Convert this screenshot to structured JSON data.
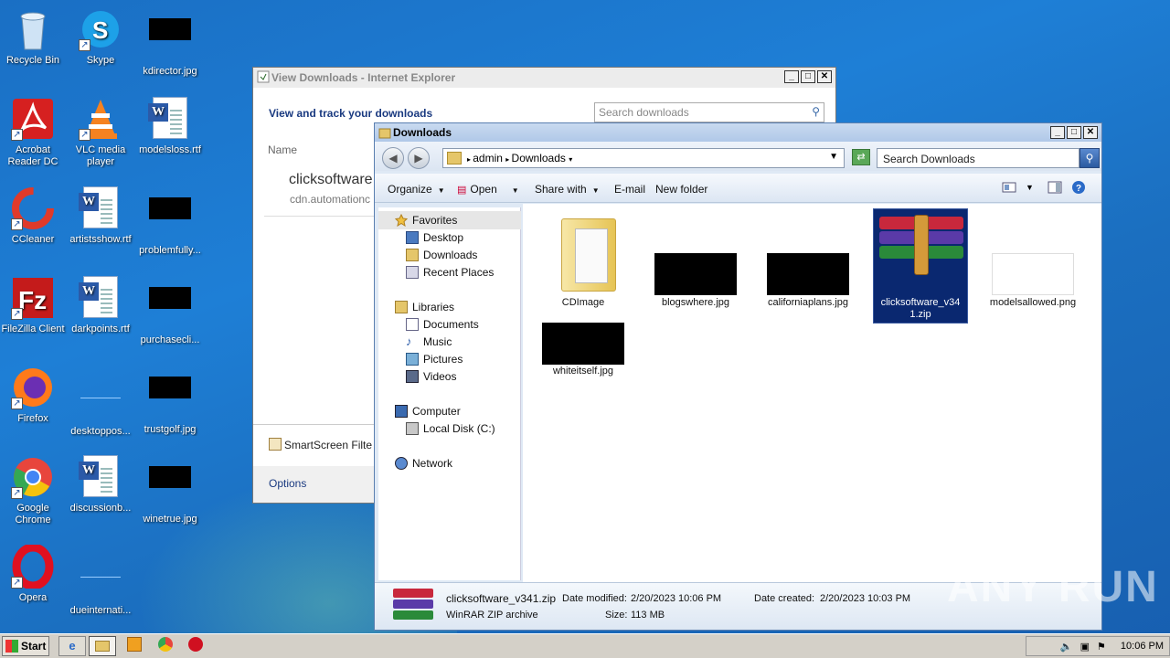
{
  "desktop": {
    "icons": [
      {
        "label": "Recycle Bin",
        "icon": "recycle-bin-icon"
      },
      {
        "label": "Skype",
        "icon": "skype-icon"
      },
      {
        "label": "kdirector.jpg",
        "icon": "image-file-icon"
      },
      {
        "label": "Acrobat Reader DC",
        "icon": "acrobat-icon"
      },
      {
        "label": "VLC media player",
        "icon": "vlc-icon"
      },
      {
        "label": "modelsloss.rtf",
        "icon": "word-doc-icon"
      },
      {
        "label": "CCleaner",
        "icon": "ccleaner-icon"
      },
      {
        "label": "artistsshow.rtf",
        "icon": "word-doc-icon"
      },
      {
        "label": "problemfully...",
        "icon": "image-file-icon"
      },
      {
        "label": "FileZilla Client",
        "icon": "filezilla-icon"
      },
      {
        "label": "darkpoints.rtf",
        "icon": "word-doc-icon"
      },
      {
        "label": "purchasecli...",
        "icon": "image-file-icon"
      },
      {
        "label": "Firefox",
        "icon": "firefox-icon"
      },
      {
        "label": "desktoppos...",
        "icon": "blank-file-icon"
      },
      {
        "label": "trustgolf.jpg",
        "icon": "image-file-icon"
      },
      {
        "label": "Google Chrome",
        "icon": "chrome-icon"
      },
      {
        "label": "discussionb...",
        "icon": "word-doc-icon"
      },
      {
        "label": "winetrue.jpg",
        "icon": "image-file-icon"
      },
      {
        "label": "Opera",
        "icon": "opera-icon"
      },
      {
        "label": "dueinternati...",
        "icon": "blank-file-icon"
      }
    ]
  },
  "ie_window": {
    "title": "View Downloads - Internet Explorer",
    "heading": "View and track your downloads",
    "search_placeholder": "Search downloads",
    "column_name": "Name",
    "item_name": "clicksoftware",
    "item_source": "cdn.automationc",
    "smartscreen": "SmartScreen Filte",
    "options": "Options"
  },
  "explorer": {
    "title": "Downloads",
    "breadcrumb": [
      "admin",
      "Downloads"
    ],
    "search_placeholder": "Search Downloads",
    "toolbar": {
      "organize": "Organize",
      "open": "Open",
      "share_with": "Share with",
      "email": "E-mail",
      "new_folder": "New folder"
    },
    "nav": {
      "favorites": "Favorites",
      "desktop": "Desktop",
      "downloads": "Downloads",
      "recent_places": "Recent Places",
      "libraries": "Libraries",
      "documents": "Documents",
      "music": "Music",
      "pictures": "Pictures",
      "videos": "Videos",
      "computer": "Computer",
      "local_disk": "Local Disk (C:)",
      "network": "Network"
    },
    "files": [
      {
        "name": "CDImage",
        "kind": "folder"
      },
      {
        "name": "blogswhere.jpg",
        "kind": "black-image"
      },
      {
        "name": "californiaplans.jpg",
        "kind": "black-image"
      },
      {
        "name": "clicksoftware_v341.zip",
        "kind": "rar",
        "selected": true
      },
      {
        "name": "modelsallowed.png",
        "kind": "white-image"
      },
      {
        "name": "whiteitself.jpg",
        "kind": "black-image"
      }
    ],
    "details": {
      "filename": "clicksoftware_v341.zip",
      "type": "WinRAR ZIP archive",
      "date_modified_label": "Date modified:",
      "date_modified": "2/20/2023 10:06 PM",
      "date_created_label": "Date created:",
      "date_created": "2/20/2023 10:03 PM",
      "size_label": "Size:",
      "size": "113 MB"
    }
  },
  "watermark": "ANY RUN",
  "taskbar": {
    "start": "Start",
    "clock": "10:06 PM"
  }
}
